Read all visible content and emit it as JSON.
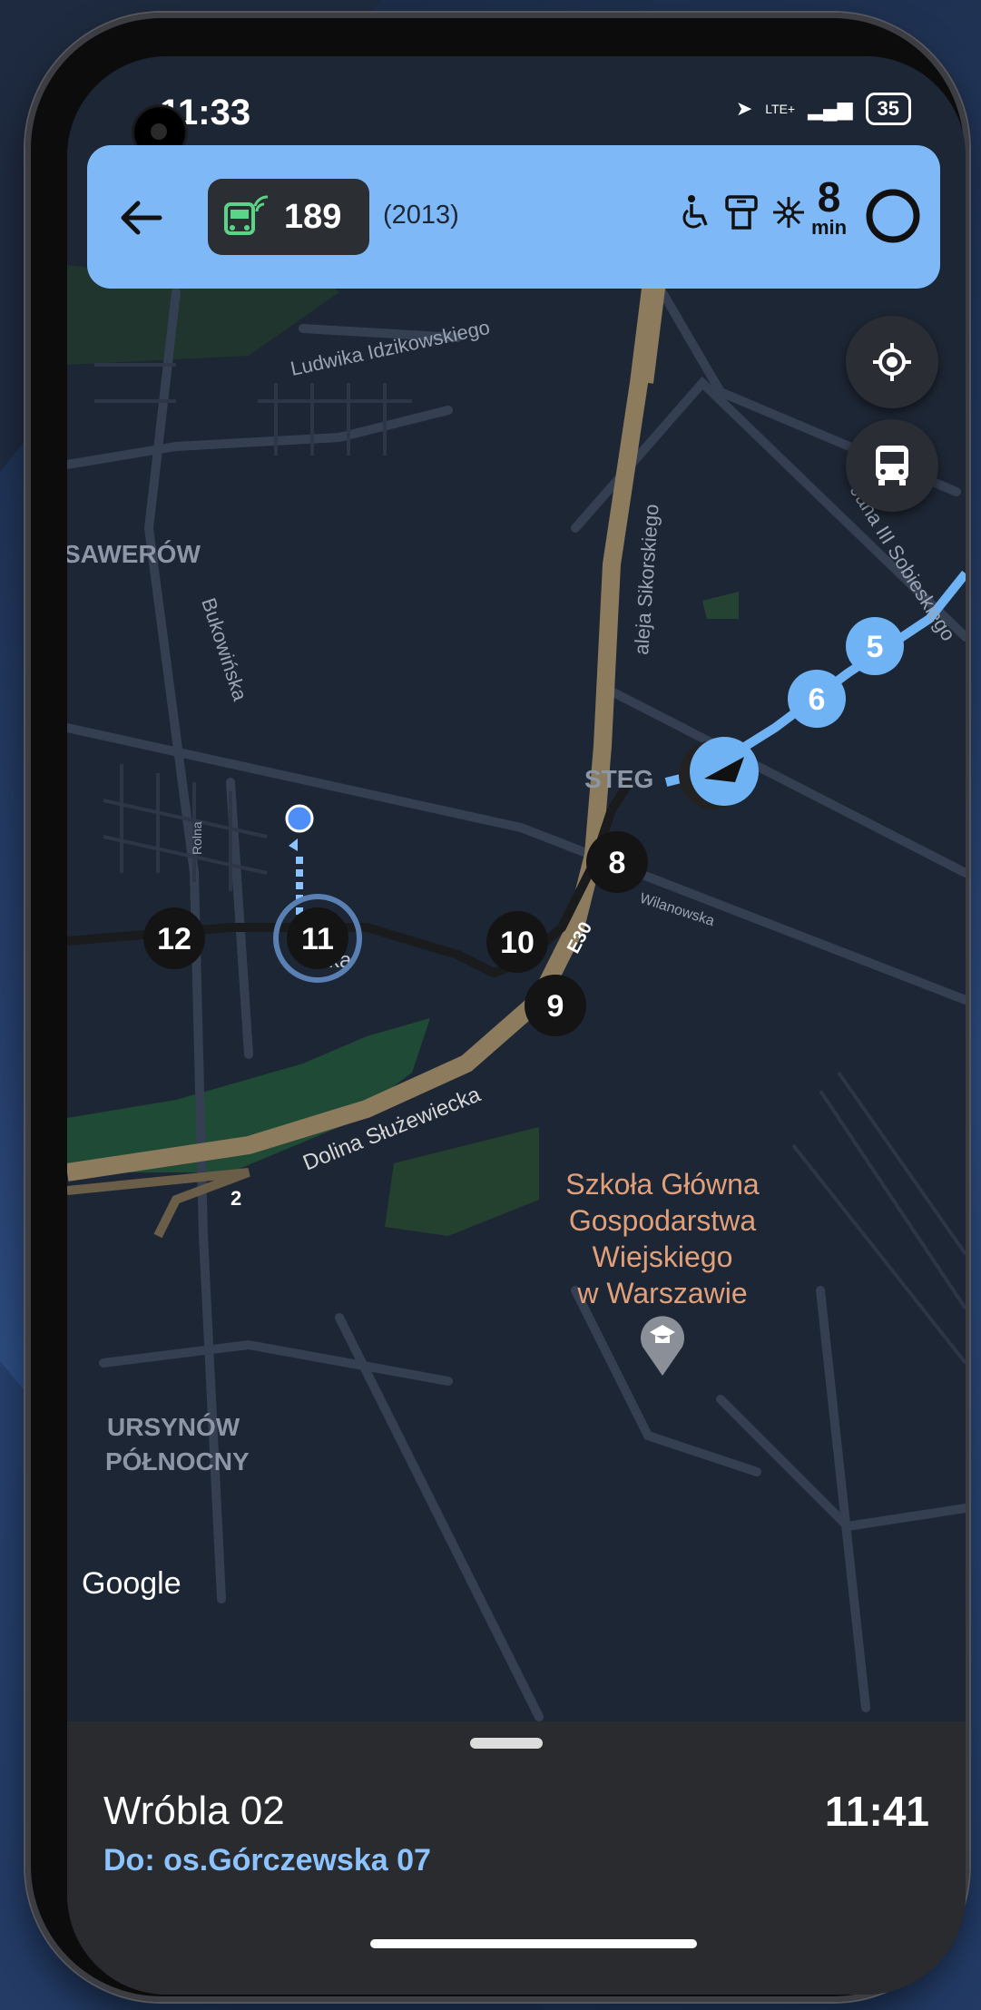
{
  "status_bar": {
    "time": "11:33",
    "network": "LTE+",
    "battery": "35"
  },
  "header": {
    "vehicle_number": "189",
    "vehicle_year": "(2013)",
    "eta_value": "8",
    "eta_unit": "min",
    "feature_icons": [
      "wheelchair-icon",
      "ticket-machine-icon",
      "air-conditioning-icon"
    ]
  },
  "map": {
    "street_labels": [
      "Ludwika Idzikowskiego",
      "aleja Sikorskiego",
      "Jana III Sobieskiego",
      "Bukowińska",
      "Rolna",
      "Wilanowska",
      "Dolina Służewiecka",
      "E30",
      "2"
    ],
    "district_labels": [
      "SAWERÓW",
      "STEG",
      "URSYNÓW",
      "PÓŁNOCNY"
    ],
    "poi": [
      "Szkoła Główna",
      "Gospodarstwa",
      "Wiejskiego",
      "w Warszawie"
    ],
    "stops": [
      {
        "num": "5",
        "state": "passed"
      },
      {
        "num": "6",
        "state": "passed"
      },
      {
        "num": "8",
        "state": "upcoming"
      },
      {
        "num": "9",
        "state": "upcoming"
      },
      {
        "num": "10",
        "state": "upcoming"
      },
      {
        "num": "11",
        "state": "selected"
      },
      {
        "num": "12",
        "state": "upcoming"
      }
    ],
    "partial_label_11": "ska",
    "attribution": "Google"
  },
  "bottom_sheet": {
    "stop_name": "Wróbla 02",
    "direction": "Do: os.Górczewska 07",
    "time": "11:41"
  },
  "colors": {
    "accent": "#7fb8f6",
    "route_passed": "#6fb3f5",
    "map_bg": "#1d2634",
    "road_major": "#8d7b5d"
  }
}
